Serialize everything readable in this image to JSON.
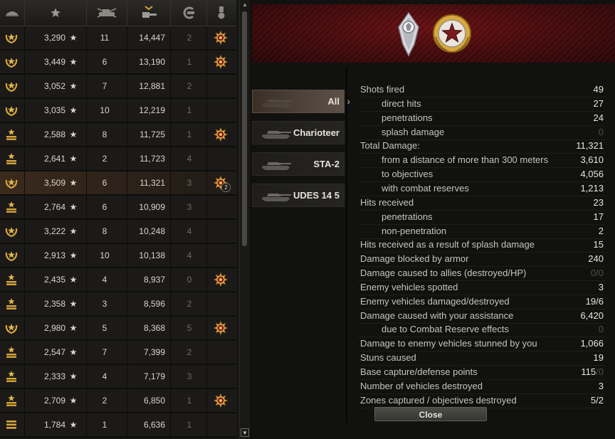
{
  "scoreboard": {
    "header_icons": [
      "rank-icon",
      "star-icon",
      "vehicles-destroyed-icon",
      "damage-icon",
      "assist-icon",
      "medal-icon"
    ],
    "star_glyph": "★",
    "rows": [
      {
        "rank": "wreath",
        "xp": "3,290",
        "kills": "11",
        "damage": "14,447",
        "assist": "2",
        "medal": true,
        "medal_count": ""
      },
      {
        "rank": "wreath",
        "xp": "3,449",
        "kills": "6",
        "damage": "13,190",
        "assist": "1",
        "medal": true,
        "medal_count": ""
      },
      {
        "rank": "wreath",
        "xp": "3,052",
        "kills": "7",
        "damage": "12,881",
        "assist": "2",
        "medal": false,
        "medal_count": ""
      },
      {
        "rank": "wreath",
        "xp": "3,035",
        "kills": "10",
        "damage": "12,219",
        "assist": "1",
        "medal": false,
        "medal_count": ""
      },
      {
        "rank": "chevron",
        "xp": "2,588",
        "kills": "8",
        "damage": "11,725",
        "assist": "1",
        "medal": true,
        "medal_count": ""
      },
      {
        "rank": "chevron",
        "xp": "2,641",
        "kills": "2",
        "damage": "11,723",
        "assist": "4",
        "medal": false,
        "medal_count": ""
      },
      {
        "rank": "wreath",
        "xp": "3,509",
        "kills": "6",
        "damage": "11,321",
        "assist": "3",
        "medal": true,
        "medal_count": "2",
        "selected": true
      },
      {
        "rank": "chevron",
        "xp": "2,764",
        "kills": "6",
        "damage": "10,909",
        "assist": "3",
        "medal": false,
        "medal_count": ""
      },
      {
        "rank": "wreath",
        "xp": "3,222",
        "kills": "8",
        "damage": "10,248",
        "assist": "4",
        "medal": false,
        "medal_count": ""
      },
      {
        "rank": "wreath",
        "xp": "2,913",
        "kills": "10",
        "damage": "10,138",
        "assist": "4",
        "medal": false,
        "medal_count": ""
      },
      {
        "rank": "chevron",
        "xp": "2,435",
        "kills": "4",
        "damage": "8,937",
        "assist": "0",
        "medal": true,
        "medal_count": ""
      },
      {
        "rank": "chevron",
        "xp": "2,358",
        "kills": "3",
        "damage": "8,596",
        "assist": "2",
        "medal": false,
        "medal_count": ""
      },
      {
        "rank": "wreath",
        "xp": "2,980",
        "kills": "5",
        "damage": "8,368",
        "assist": "5",
        "medal": true,
        "medal_count": ""
      },
      {
        "rank": "chevron",
        "xp": "2,547",
        "kills": "7",
        "damage": "7,399",
        "assist": "2",
        "medal": false,
        "medal_count": ""
      },
      {
        "rank": "chevron",
        "xp": "2,333",
        "kills": "4",
        "damage": "7,179",
        "assist": "3",
        "medal": false,
        "medal_count": ""
      },
      {
        "rank": "chevron",
        "xp": "2,709",
        "kills": "2",
        "damage": "6,850",
        "assist": "1",
        "medal": true,
        "medal_count": ""
      },
      {
        "rank": "bars",
        "xp": "1,784",
        "kills": "1",
        "damage": "6,636",
        "assist": "1",
        "medal": false,
        "medal_count": ""
      }
    ]
  },
  "player_badges": [
    "rank-emblem-icon",
    "wreath-star-emblem-icon"
  ],
  "vehicles": [
    {
      "label": "All",
      "active": true
    },
    {
      "label": "Charioteer",
      "active": false
    },
    {
      "label": "STA-2",
      "active": false
    },
    {
      "label": "UDES 14 5",
      "active": false
    }
  ],
  "stats": [
    {
      "label": "Shots fired",
      "value": "49",
      "indent": false
    },
    {
      "label": "direct hits",
      "value": "27",
      "indent": true
    },
    {
      "label": "penetrations",
      "value": "24",
      "indent": true
    },
    {
      "label": "splash damage",
      "value": "0",
      "indent": true,
      "dim": true
    },
    {
      "label": "Total Damage:",
      "value": "11,321",
      "indent": false
    },
    {
      "label": "from a distance of more than 300 meters",
      "value": "3,610",
      "indent": true
    },
    {
      "label": "to objectives",
      "value": "4,056",
      "indent": true
    },
    {
      "label": "with combat reserves",
      "value": "1,213",
      "indent": true
    },
    {
      "label": "Hits received",
      "value": "23",
      "indent": false
    },
    {
      "label": "penetrations",
      "value": "17",
      "indent": true
    },
    {
      "label": "non-penetration",
      "value": "2",
      "indent": true
    },
    {
      "label": "Hits received as a result of splash damage",
      "value": "15",
      "indent": false
    },
    {
      "label": "Damage blocked by armor",
      "value": "240",
      "indent": false
    },
    {
      "label": "Damage caused to allies (destroyed/HP)",
      "value": "0/0",
      "indent": false,
      "dim": true
    },
    {
      "label": "Enemy vehicles spotted",
      "value": "3",
      "indent": false
    },
    {
      "label": "Enemy vehicles damaged/destroyed",
      "value": "19/6",
      "indent": false
    },
    {
      "label": "Damage caused with your assistance",
      "value": "6,420",
      "indent": false
    },
    {
      "label": "due to Combat Reserve effects",
      "value": "0",
      "indent": true,
      "dim": true
    },
    {
      "label": "Damage to enemy vehicles stunned by you",
      "value": "1,066",
      "indent": false
    },
    {
      "label": "Stuns caused",
      "value": "19",
      "indent": false
    },
    {
      "label": "Base capture/defense points",
      "value": "115",
      "value_dim_suffix": "/0",
      "indent": false
    },
    {
      "label": "Number of vehicles destroyed",
      "value": "3",
      "indent": false
    },
    {
      "label": "Zones captured / objectives destroyed",
      "value": "5/2",
      "indent": false
    }
  ],
  "close_button": {
    "label": "Close"
  },
  "colors": {
    "accent_red": "#4a0c0e",
    "gold": "#d6a53a",
    "text": "#e8e5dc",
    "dim": "#4f4d49"
  }
}
